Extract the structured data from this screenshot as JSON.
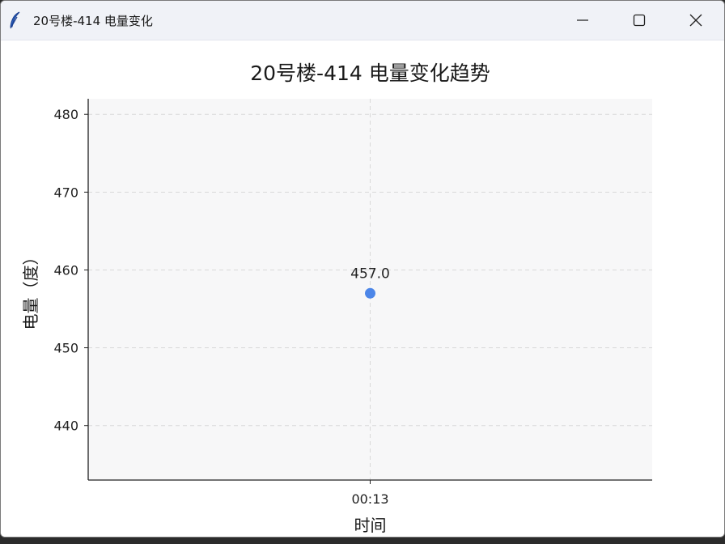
{
  "window": {
    "title": "20号楼-414 电量变化",
    "icon": "feather-icon",
    "controls": {
      "minimize_icon": "minimize-icon",
      "maximize_icon": "maximize-icon",
      "close_icon": "close-icon"
    }
  },
  "chart_data": {
    "type": "scatter",
    "title": "20号楼-414 电量变化趋势",
    "xlabel": "时间",
    "ylabel": "电量（度）",
    "categories": [
      "00:13"
    ],
    "series": [
      {
        "values": [
          457.0
        ],
        "labels": [
          "457.0"
        ],
        "color": "#4c86e8"
      }
    ],
    "ylim": [
      433,
      482
    ],
    "yticks": [
      440,
      450,
      460,
      470,
      480
    ],
    "grid": true,
    "grid_style": "dashed",
    "background": "#f7f7f8"
  }
}
